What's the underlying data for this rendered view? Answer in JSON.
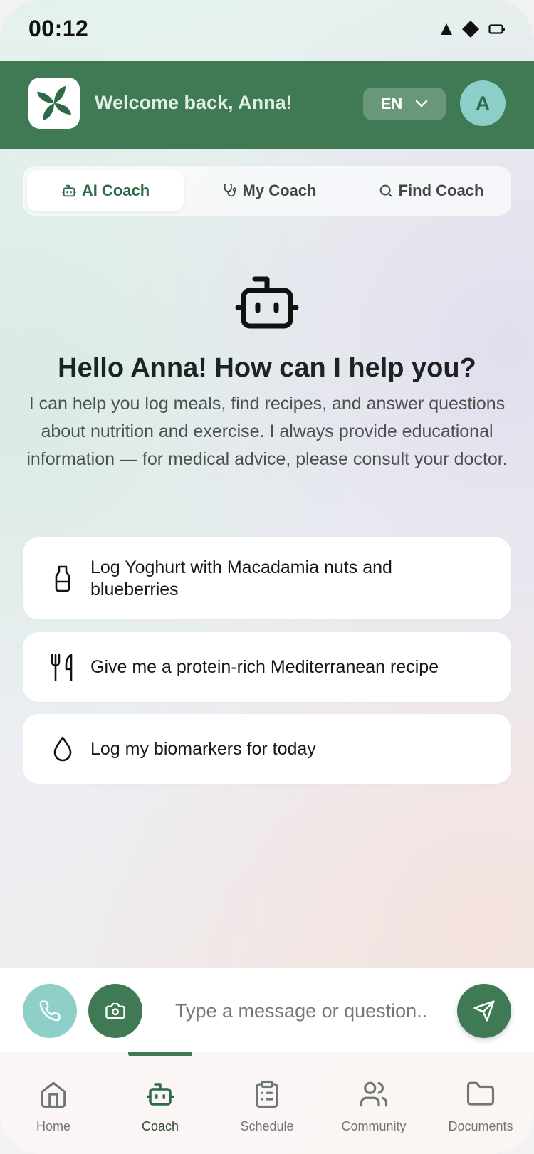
{
  "status_bar": {
    "time": "00:12",
    "icons": [
      "signal-icon",
      "wifi-icon",
      "battery-icon"
    ]
  },
  "header": {
    "logo_icon": "pinwheel-leaf-logo",
    "welcome": "Welcome back, Anna!",
    "language": "EN",
    "avatar_initial": "A"
  },
  "tabs": [
    {
      "label": "AI Coach",
      "icon": "robot-icon",
      "active": true
    },
    {
      "label": "My Coach",
      "icon": "stethoscope-icon",
      "active": false
    },
    {
      "label": "Find Coach",
      "icon": "search-icon",
      "active": false
    }
  ],
  "hero": {
    "icon": "robot-icon",
    "title": "Hello Anna! How can I help you?",
    "description": "I can help you log meals, find recipes, and answer questions about nutrition and exercise. I always provide educational information — for medical advice, please consult your doctor."
  },
  "suggestions": [
    {
      "label": "Log Yoghurt with Macadamia nuts and blueberries",
      "icon": "milk-bottle-icon"
    },
    {
      "label": "Give me a protein-rich Mediterranean recipe",
      "icon": "fork-knife-icon"
    },
    {
      "label": "Log my biomarkers for today",
      "icon": "droplet-icon"
    }
  ],
  "composer": {
    "placeholder": "Type a message or question...",
    "call_icon": "phone-icon",
    "camera_icon": "camera-icon",
    "send_icon": "send-icon"
  },
  "nav": [
    {
      "label": "Home",
      "icon": "home-icon",
      "active": false
    },
    {
      "label": "Coach",
      "icon": "robot-icon",
      "active": true
    },
    {
      "label": "Schedule",
      "icon": "clipboard-icon",
      "active": false
    },
    {
      "label": "Community",
      "icon": "users-icon",
      "active": false
    },
    {
      "label": "Documents",
      "icon": "folder-icon",
      "active": false
    }
  ],
  "colors": {
    "brand_green": "#3f7a55",
    "teal": "#8fcfc9",
    "text_dark": "#1a2420"
  }
}
